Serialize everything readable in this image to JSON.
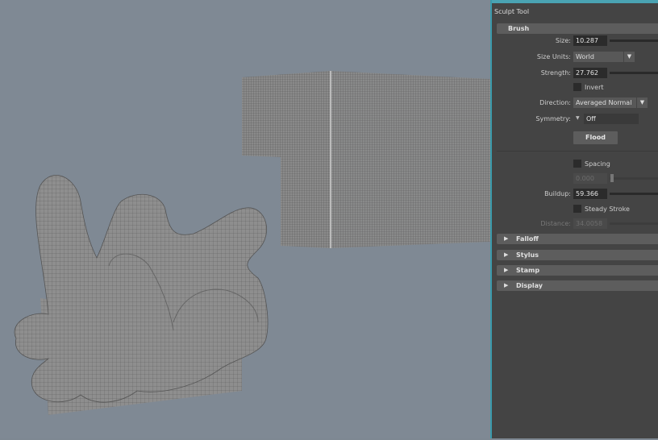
{
  "panel": {
    "title": "Sculpt Tool",
    "brush": {
      "header": "Brush",
      "size": {
        "label": "Size:",
        "value": "10.287"
      },
      "size_units": {
        "label": "Size Units:",
        "value": "World"
      },
      "strength": {
        "label": "Strength:",
        "value": "27.762"
      },
      "invert": {
        "label": "Invert",
        "checked": false
      },
      "direction": {
        "label": "Direction:",
        "value": "Averaged Normal"
      },
      "symmetry": {
        "label": "Symmetry:",
        "value": "Off"
      },
      "flood_label": "Flood",
      "spacing": {
        "label": "Spacing",
        "checked": false,
        "value": "0.000"
      },
      "buildup": {
        "label": "Buildup:",
        "value": "59.366"
      },
      "steady_stroke": {
        "label": "Steady Stroke",
        "checked": false
      },
      "distance": {
        "label": "Distance:",
        "value": "34.0058"
      }
    },
    "sections": [
      "Falloff",
      "Stylus",
      "Stamp",
      "Display"
    ]
  },
  "colors": {
    "viewport": "#7f8994",
    "panel": "#444444",
    "accent": "#4aa3b3"
  }
}
